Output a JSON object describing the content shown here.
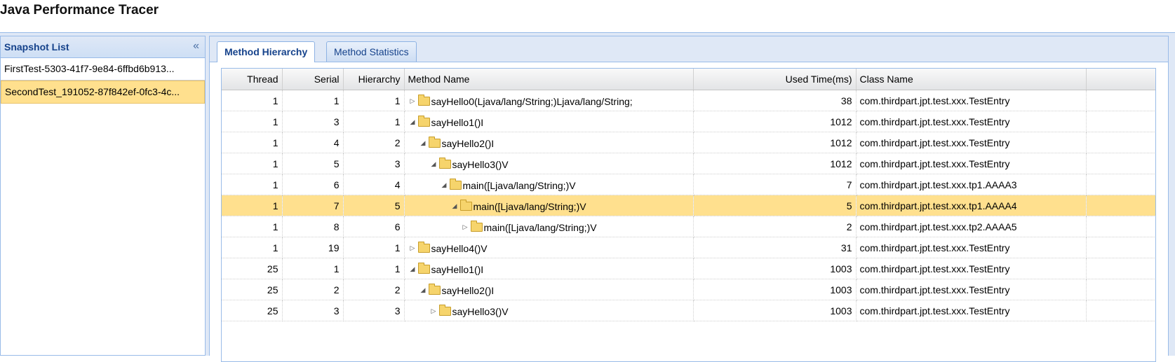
{
  "app": {
    "title": "Java Performance Tracer"
  },
  "west": {
    "title": "Snapshot List",
    "collapse_glyph": "«",
    "items": [
      {
        "label": "FirstTest-5303-41f7-9e84-6ffbd6b913...",
        "selected": false
      },
      {
        "label": "SecondTest_191052-87f842ef-0fc3-4c...",
        "selected": true
      }
    ]
  },
  "tabs": [
    {
      "label": "Method Hierarchy",
      "active": true
    },
    {
      "label": "Method Statistics",
      "active": false
    }
  ],
  "grid": {
    "columns": [
      "Thread",
      "Serial",
      "Hierarchy",
      "Method Name",
      "Used Time(ms)",
      "Class Name"
    ],
    "rows": [
      {
        "thread": "1",
        "serial": "1",
        "hierarchy": "1",
        "method": "sayHello0(Ljava/lang/String;)Ljava/lang/String;",
        "time": "38",
        "class": "com.thirdpart.jpt.test.xxx.TestEntry",
        "expanded": false,
        "selected": false
      },
      {
        "thread": "1",
        "serial": "3",
        "hierarchy": "1",
        "method": "sayHello1()I",
        "time": "1012",
        "class": "com.thirdpart.jpt.test.xxx.TestEntry",
        "expanded": true,
        "selected": false
      },
      {
        "thread": "1",
        "serial": "4",
        "hierarchy": "2",
        "method": "sayHello2()I",
        "time": "1012",
        "class": "com.thirdpart.jpt.test.xxx.TestEntry",
        "expanded": true,
        "selected": false
      },
      {
        "thread": "1",
        "serial": "5",
        "hierarchy": "3",
        "method": "sayHello3()V",
        "time": "1012",
        "class": "com.thirdpart.jpt.test.xxx.TestEntry",
        "expanded": true,
        "selected": false
      },
      {
        "thread": "1",
        "serial": "6",
        "hierarchy": "4",
        "method": "main([Ljava/lang/String;)V",
        "time": "7",
        "class": "com.thirdpart.jpt.test.xxx.tp1.AAAA3",
        "expanded": true,
        "selected": false
      },
      {
        "thread": "1",
        "serial": "7",
        "hierarchy": "5",
        "method": "main([Ljava/lang/String;)V",
        "time": "5",
        "class": "com.thirdpart.jpt.test.xxx.tp1.AAAA4",
        "expanded": true,
        "selected": true
      },
      {
        "thread": "1",
        "serial": "8",
        "hierarchy": "6",
        "method": "main([Ljava/lang/String;)V",
        "time": "2",
        "class": "com.thirdpart.jpt.test.xxx.tp2.AAAA5",
        "expanded": false,
        "selected": false
      },
      {
        "thread": "1",
        "serial": "19",
        "hierarchy": "1",
        "method": "sayHello4()V",
        "time": "31",
        "class": "com.thirdpart.jpt.test.xxx.TestEntry",
        "expanded": false,
        "selected": false
      },
      {
        "thread": "25",
        "serial": "1",
        "hierarchy": "1",
        "method": "sayHello1()I",
        "time": "1003",
        "class": "com.thirdpart.jpt.test.xxx.TestEntry",
        "expanded": true,
        "selected": false
      },
      {
        "thread": "25",
        "serial": "2",
        "hierarchy": "2",
        "method": "sayHello2()I",
        "time": "1003",
        "class": "com.thirdpart.jpt.test.xxx.TestEntry",
        "expanded": true,
        "selected": false
      },
      {
        "thread": "25",
        "serial": "3",
        "hierarchy": "3",
        "method": "sayHello3()V",
        "time": "1003",
        "class": "com.thirdpart.jpt.test.xxx.TestEntry",
        "expanded": false,
        "selected": false
      }
    ]
  },
  "icons": {
    "expanded": "triangle-expanded-icon",
    "collapsed": "triangle-collapsed-icon",
    "folder": "folder-icon"
  },
  "colors": {
    "selection": "#ffe08e",
    "header_text": "#15428b",
    "border": "#99bbe8"
  }
}
